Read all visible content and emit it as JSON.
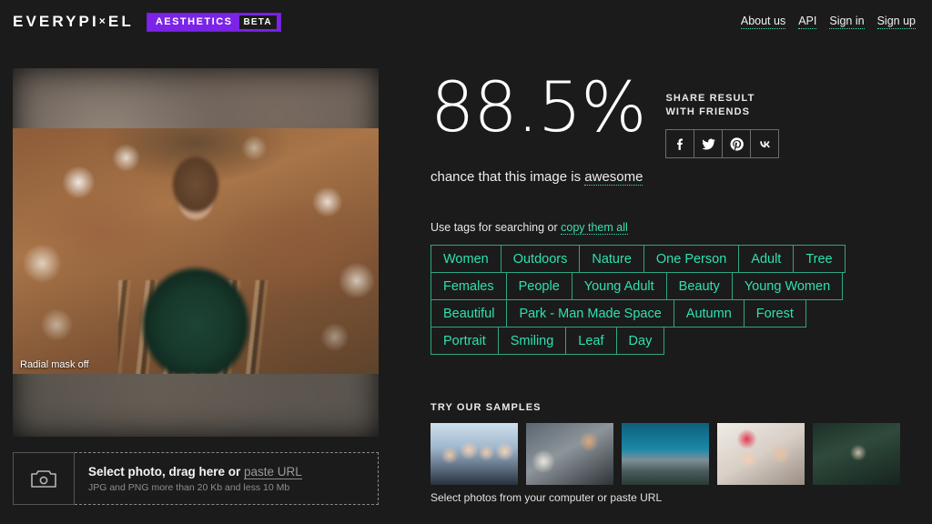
{
  "header": {
    "logo_main": "EVERYPI",
    "logo_x": "×",
    "logo_tail": "EL",
    "badge_label": "AESTHETICS",
    "badge_beta": "BETA",
    "nav": [
      {
        "label": "About us"
      },
      {
        "label": "API"
      },
      {
        "label": "Sign in"
      },
      {
        "label": "Sign up"
      }
    ]
  },
  "photo": {
    "caption": "Radial mask off"
  },
  "upload": {
    "icon": "camera-icon",
    "title_prefix": "Select photo, drag here or ",
    "paste_url": "paste URL",
    "subtitle": "JPG and PNG more than 20 Kb and less 10 Mb"
  },
  "result": {
    "percent": "88.5%",
    "chance_prefix": "chance that this image is ",
    "chance_highlight": "awesome",
    "share_line1": "SHARE RESULT",
    "share_line2": "WITH FRIENDS",
    "share_icons": [
      {
        "name": "facebook-icon",
        "label": "Facebook"
      },
      {
        "name": "twitter-icon",
        "label": "Twitter"
      },
      {
        "name": "pinterest-icon",
        "label": "Pinterest"
      },
      {
        "name": "vk-icon",
        "label": "VK"
      }
    ]
  },
  "tags_section": {
    "header_prefix": "Use tags for searching or ",
    "copy_all": "copy them all",
    "rows": [
      [
        "Women",
        "Outdoors",
        "Nature",
        "One Person",
        "Adult",
        "Tree"
      ],
      [
        "Females",
        "People",
        "Young Adult",
        "Beauty",
        "Young Women"
      ],
      [
        "Beautiful",
        "Park - Man Made Space",
        "Autumn",
        "Forest"
      ],
      [
        "Portrait",
        "Smiling",
        "Leaf",
        "Day"
      ]
    ]
  },
  "samples": {
    "header": "TRY OUR SAMPLES",
    "footer": "Select photos from your computer or paste URL",
    "thumbs": [
      {
        "name": "sample-business-team"
      },
      {
        "name": "sample-office-desk"
      },
      {
        "name": "sample-mountains"
      },
      {
        "name": "sample-winter-couple"
      },
      {
        "name": "sample-forest-couple"
      }
    ]
  },
  "colors": {
    "background": "#1b1b1b",
    "accent_teal": "#2fe0b0",
    "badge_purple": "#7b24e8"
  }
}
